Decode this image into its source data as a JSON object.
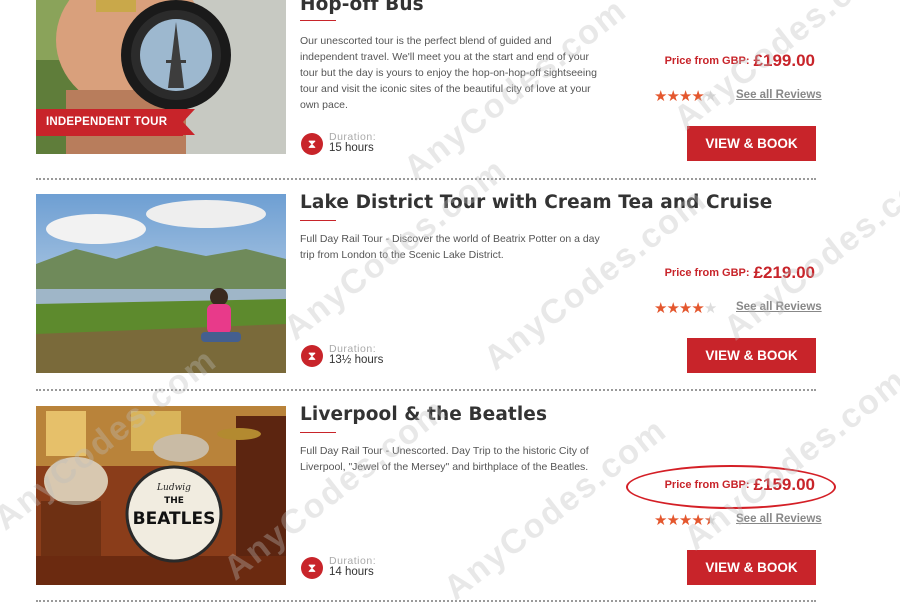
{
  "tours": [
    {
      "title": "Hop-off Bus",
      "badge": "INDEPENDENT TOUR",
      "description": "Our unescorted tour is the perfect blend of guided and independent travel. We'll meet you at the start and end of your tour but the day is yours to enjoy the hop-on-hop-off sightseeing tour and visit the iconic sites of the beautiful city of love at your own pace.",
      "duration_label": "Duration:",
      "duration": "15 hours",
      "price_label": "Price from GBP:",
      "price": "£199.00",
      "rating": 4,
      "rating_max": 5,
      "reviews_link": "See all Reviews",
      "button": "VIEW & BOOK"
    },
    {
      "title": "Lake District Tour with Cream Tea and Cruise",
      "description": "Full Day Rail Tour - Discover the world of Beatrix Potter on a day trip from London to the Scenic Lake District.",
      "duration_label": "Duration:",
      "duration": "13½ hours",
      "price_label": "Price from GBP:",
      "price": "£219.00",
      "rating": 4,
      "rating_max": 5,
      "reviews_link": "See all Reviews",
      "button": "VIEW & BOOK"
    },
    {
      "title": "Liverpool & the Beatles",
      "description": "Full Day Rail Tour - Unescorted. Day Trip to the historic City of Liverpool, \"Jewel of the Mersey\" and birthplace of the Beatles.",
      "duration_label": "Duration:",
      "duration": "14 hours",
      "price_label": "Price from GBP:",
      "price": "£159.00",
      "rating": 4.5,
      "rating_max": 5,
      "reviews_link": "See all Reviews",
      "button": "VIEW & BOOK",
      "drum_text": "THE BEATLES",
      "drum_brand": "Ludwig"
    }
  ],
  "watermark": "AnyCodes.com",
  "colors": {
    "accent": "#c8242a",
    "star": "#e4572e",
    "highlight_circle": "#d41f26"
  },
  "icons": {
    "duration": "hourglass-icon",
    "rating": "star-icon"
  }
}
